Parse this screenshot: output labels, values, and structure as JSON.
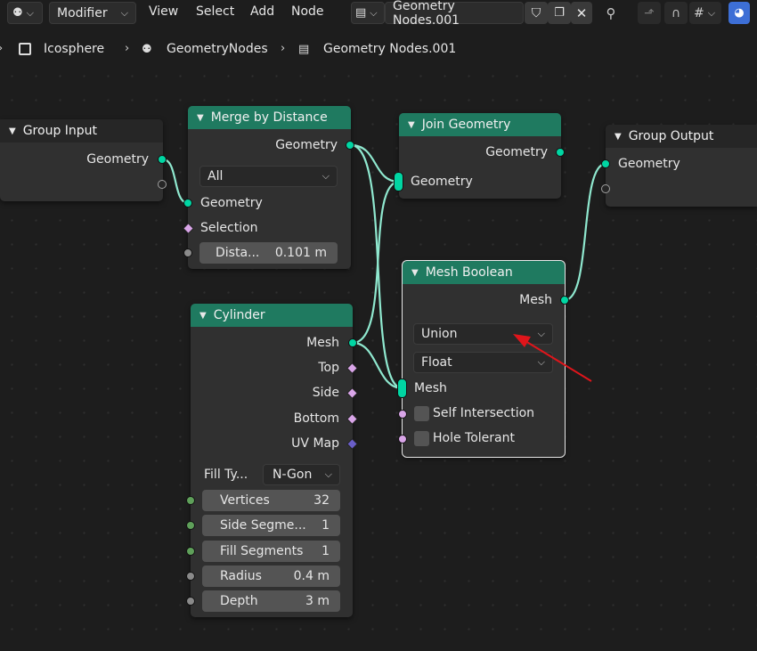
{
  "header": {
    "editor_type_icon": "node-editor-icon",
    "mode_dropdown": "Modifier",
    "menus": [
      "View",
      "Select",
      "Add",
      "Node"
    ],
    "node_tree_name": "Geometry Nodes.001"
  },
  "breadcrumb": {
    "items": [
      "Icosphere",
      "GeometryNodes",
      "Geometry Nodes.001"
    ]
  },
  "nodes": {
    "group_input": {
      "title": "Group Input",
      "outputs": [
        "Geometry"
      ]
    },
    "merge": {
      "title": "Merge by Distance",
      "output": "Geometry",
      "mode": "All",
      "inputs": [
        "Geometry",
        "Selection"
      ],
      "distance_label": "Dista...",
      "distance_value": "0.101 m"
    },
    "join": {
      "title": "Join Geometry",
      "output": "Geometry",
      "input": "Geometry"
    },
    "group_output": {
      "title": "Group Output",
      "inputs": [
        "Geometry"
      ]
    },
    "boolean": {
      "title": "Mesh Boolean",
      "output": "Mesh",
      "operation": "Union",
      "solver": "Float",
      "input_mesh": "Mesh",
      "self_intersection": "Self Intersection",
      "hole_tolerant": "Hole Tolerant"
    },
    "cylinder": {
      "title": "Cylinder",
      "outputs": [
        "Mesh",
        "Top",
        "Side",
        "Bottom",
        "UV Map"
      ],
      "fill_type_label": "Fill Ty...",
      "fill_type_value": "N-Gon",
      "fields": [
        {
          "label": "Vertices",
          "value": "32"
        },
        {
          "label": "Side Segme...",
          "value": "1"
        },
        {
          "label": "Fill Segments",
          "value": "1"
        },
        {
          "label": "Radius",
          "value": "0.4 m"
        },
        {
          "label": "Depth",
          "value": "3 m"
        }
      ]
    }
  },
  "colors": {
    "node_header_green": "#1f7a60",
    "geometry_socket": "#00d6a3",
    "link": "#8fe8cf",
    "annotation_arrow": "#e0151b"
  }
}
